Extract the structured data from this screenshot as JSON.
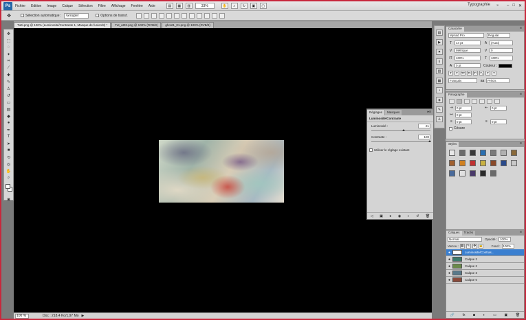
{
  "app": {
    "logo": "Ps",
    "workspace": "Typographie"
  },
  "menu": [
    "Fichier",
    "Edition",
    "Image",
    "Calque",
    "Sélection",
    "Filtre",
    "Affichage",
    "Fenêtre",
    "Aide"
  ],
  "menubar": {
    "zoom": "33%"
  },
  "options": {
    "auto_select_label": "Sélection automatique :",
    "auto_select_value": "Grouper",
    "transform_label": "Options de transf."
  },
  "tabs": [
    "Tutti.png @ 100% (Luminosité/Contraste 1, Masque de fusion/8) *",
    "Tut_at03.png @ 100% (RVB/8)",
    "ghost1_01.png @ 100% (RVB/8)"
  ],
  "statusbar": {
    "zoom": "100 %",
    "doc": "Doc : 218,4 Ko/1,97 Mo"
  },
  "adjustments": {
    "tabs": [
      "Réglages",
      "Masques"
    ],
    "title": "Luminosité/Contraste",
    "brightness_label": "Luminosité :",
    "brightness_value": "21",
    "contrast_label": "Contraste :",
    "contrast_value": "100",
    "legacy_label": "Utiliser le réglage existant"
  },
  "character": {
    "tab": "Caractère",
    "font": "Myriad Pro",
    "style": "Regular",
    "size": "14 pt",
    "leading": "(Auto)",
    "kerning": "Métrique",
    "tracking": "0",
    "vscale": "100%",
    "hscale": "100%",
    "baseline": "0 pt",
    "color_label": "Couleur :",
    "language": "Français",
    "antialias": "Précis"
  },
  "paragraph": {
    "tab": "Paragraphe",
    "indent_left": "0 pt",
    "indent_right": "0 pt",
    "first_line": "0 pt",
    "space_before": "0 pt",
    "space_after": "0 pt",
    "hyphenate": "Césure"
  },
  "styles": {
    "tab": "Styles",
    "swatches": [
      "#e8e8e8",
      "#6a6a6a",
      "#3a3a3a",
      "#2a6fb0",
      "#7a7a7a",
      "#b0b0b0",
      "#8a6a3a",
      "#a06030",
      "#d08020",
      "#c03030",
      "#c8b040",
      "#8a4a2a",
      "#2a4a8a",
      "#c8c8c8",
      "#4a6a9a",
      "#e0e0e0",
      "#4a3a6a",
      "#2a2a2a",
      "#6a6a6a"
    ]
  },
  "layers": {
    "tabs": [
      "Calques",
      "Tracés"
    ],
    "blend": "Normal",
    "opacity_label": "Opacité :",
    "opacity": "100%",
    "lock_label": "Verrou :",
    "fill_label": "Fond :",
    "fill": "100%",
    "items": [
      {
        "name": "Luminosité/Contras...",
        "thumb": "#ffffff"
      },
      {
        "name": "Calque 2",
        "thumb": "#3d7a6a"
      },
      {
        "name": "Calque 2",
        "thumb": "#6a8a4a"
      },
      {
        "name": "Calque 3",
        "thumb": "#5a7a8a"
      },
      {
        "name": "Calque 0",
        "thumb": "#8a4a3a"
      }
    ]
  }
}
